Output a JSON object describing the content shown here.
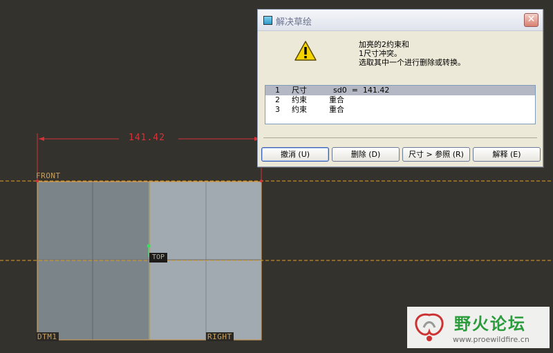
{
  "sketch": {
    "dimension_value": "141.42",
    "plane_labels": {
      "front": "FRONT",
      "top": "TOP",
      "dtm1": "DTM1",
      "right": "RIGHT"
    }
  },
  "dialog": {
    "title": "解决草绘",
    "close_glyph": "✕",
    "message_lines": [
      "加亮的2约束和",
      "1尺寸冲突。",
      "选取其中一个进行删除或转换。"
    ],
    "conflicts": [
      {
        "num": "1",
        "type": "尺寸",
        "detail": "sd0  =  141.42",
        "selected": true
      },
      {
        "num": "2",
        "type": "约束",
        "detail": "重合",
        "selected": false
      },
      {
        "num": "3",
        "type": "约束",
        "detail": "重合",
        "selected": false
      }
    ],
    "buttons": {
      "undo": "撤消 (U)",
      "delete": "删除 (D)",
      "dim_to_ref": "尺寸 > 参照 (R)",
      "explain": "解释 (E)"
    }
  },
  "watermark": {
    "title": "野火论坛",
    "url": "www.proewildfire.cn"
  },
  "colors": {
    "background": "#34322d",
    "dimension": "#d5323a",
    "reference_line": "#e0a030",
    "accent_green": "#2a9c3c"
  }
}
